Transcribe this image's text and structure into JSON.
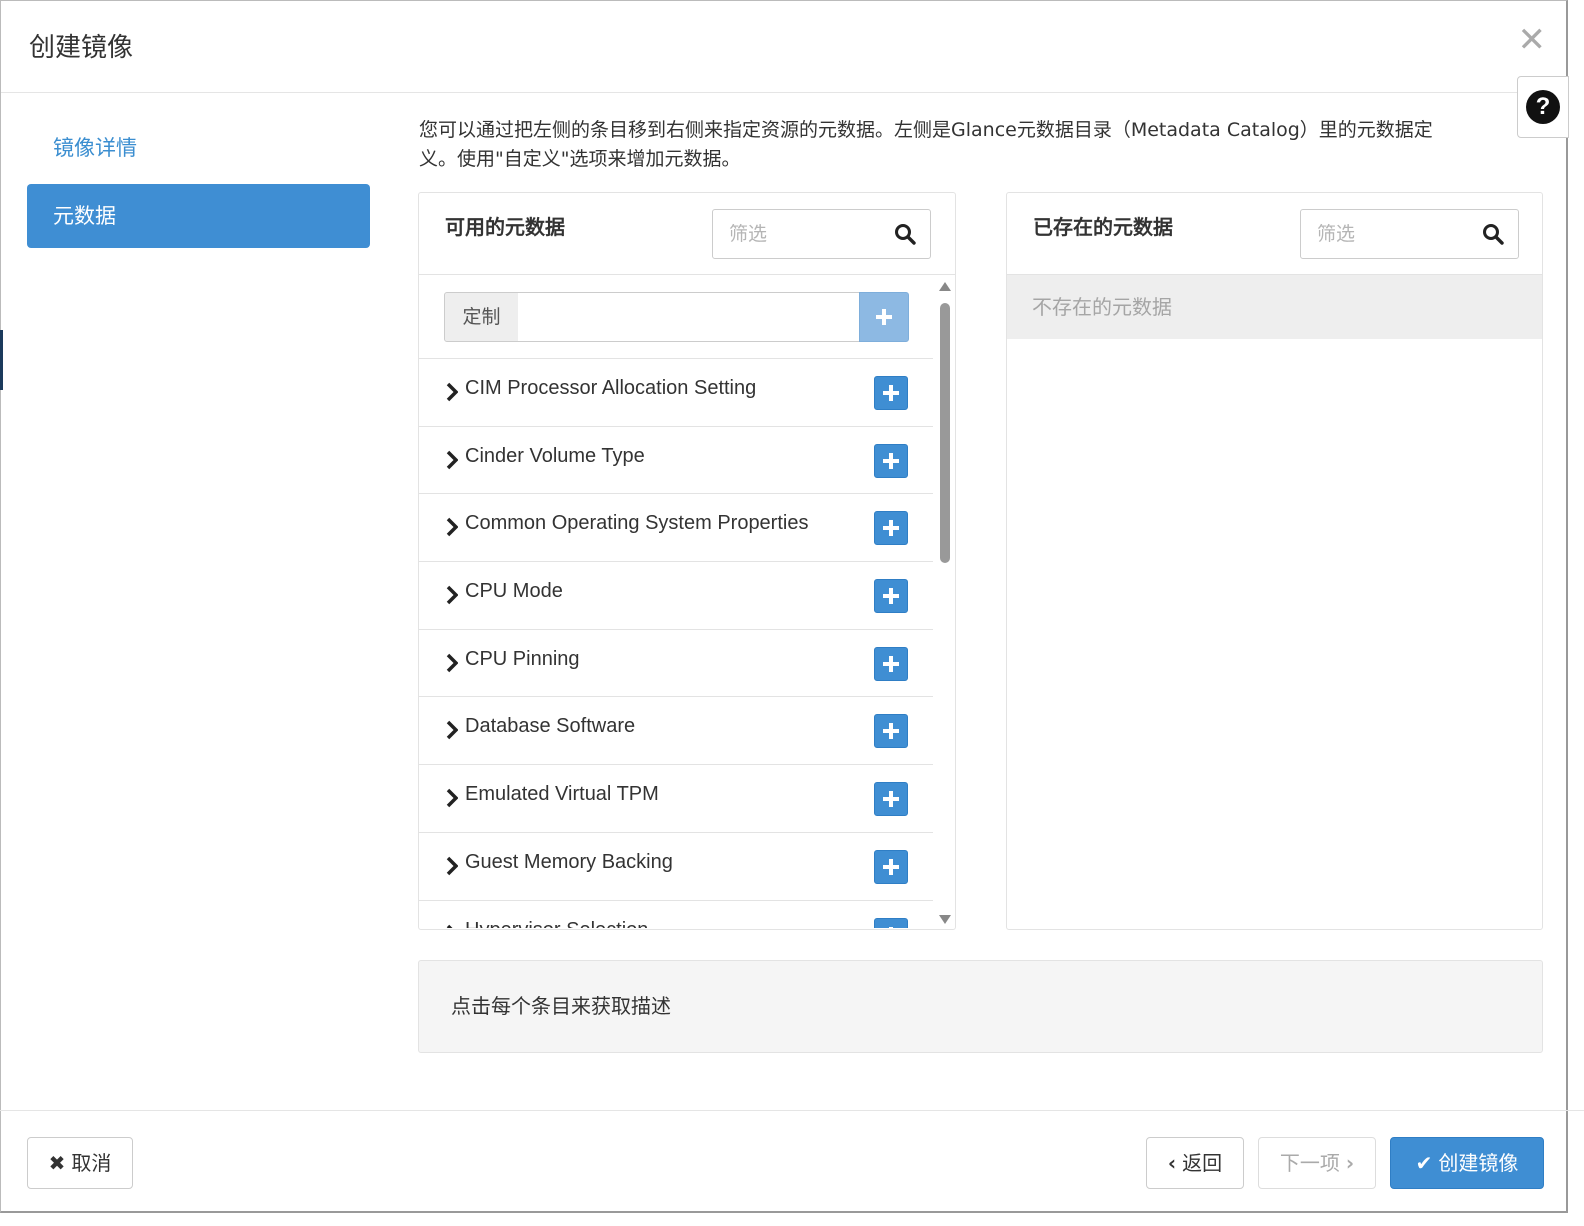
{
  "modal": {
    "title": "创建镜像",
    "close_icon": "close-icon",
    "help_glyph": "?"
  },
  "nav": {
    "items": [
      {
        "label": "镜像详情",
        "active": false
      },
      {
        "label": "元数据",
        "active": true
      }
    ]
  },
  "intro_text": "您可以通过把左侧的条目移到右侧来指定资源的元数据。左侧是Glance元数据目录（Metadata Catalog）里的元数据定义。使用\"自定义\"选项来增加元数据。",
  "available": {
    "title": "可用的元数据",
    "filter_placeholder": "筛选",
    "custom_label": "定制",
    "custom_value": "",
    "items": [
      "CIM Processor Allocation Setting",
      "Cinder Volume Type",
      "Common Operating System Properties",
      "CPU Mode",
      "CPU Pinning",
      "Database Software",
      "Emulated Virtual TPM",
      "Guest Memory Backing",
      "Hypervisor Selection"
    ]
  },
  "existing": {
    "title": "已存在的元数据",
    "filter_placeholder": "筛选",
    "empty_text": "不存在的元数据"
  },
  "description": "点击每个条目来获取描述",
  "footer": {
    "cancel": "取消",
    "back": "返回",
    "next": "下一项",
    "create": "创建镜像"
  },
  "colors": {
    "primary": "#3f8ed3",
    "link": "#3b8ed0",
    "disabled_text": "#aaaaaa"
  }
}
